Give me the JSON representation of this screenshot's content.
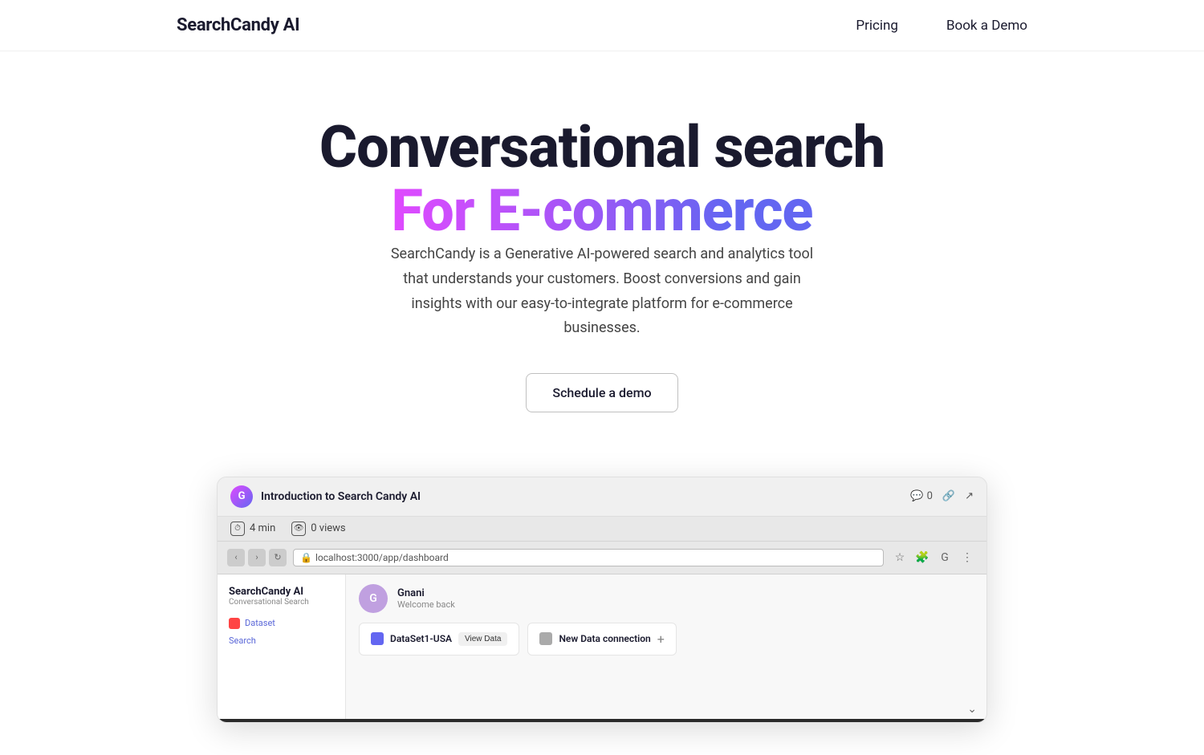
{
  "header": {
    "logo": "SearchCandy AI",
    "nav": {
      "pricing": "Pricing",
      "book_demo": "Book a Demo"
    }
  },
  "hero": {
    "title_line1": "Conversational search",
    "title_line2": "For E-commerce",
    "description": "SearchCandy is a Generative AI-powered search and analytics tool that understands your customers. Boost conversions and gain insights with our easy-to-integrate platform for e-commerce businesses.",
    "cta_label": "Schedule a demo"
  },
  "video": {
    "avatar_letter": "G",
    "title": "Introduction to Search Candy AI",
    "comments_icon": "💬",
    "comments_count": "0",
    "link_icon": "🔗",
    "external_icon": "↗",
    "chevron_icon": "⌄",
    "duration": "4 min",
    "views": "0 views",
    "browser_url": "localhost:3000/app/dashboard",
    "app": {
      "sidebar_title": "SearchCandy AI",
      "sidebar_sub": "Conversational Search",
      "sidebar_item": "Dataset",
      "search_label": "Search",
      "user_avatar": "G",
      "user_name": "Gnani",
      "user_welcome": "Welcome back",
      "card1_label": "DataSet1-USA",
      "card1_btn": "View Data",
      "card2_label": "New Data connection",
      "card2_icon": "+"
    }
  }
}
